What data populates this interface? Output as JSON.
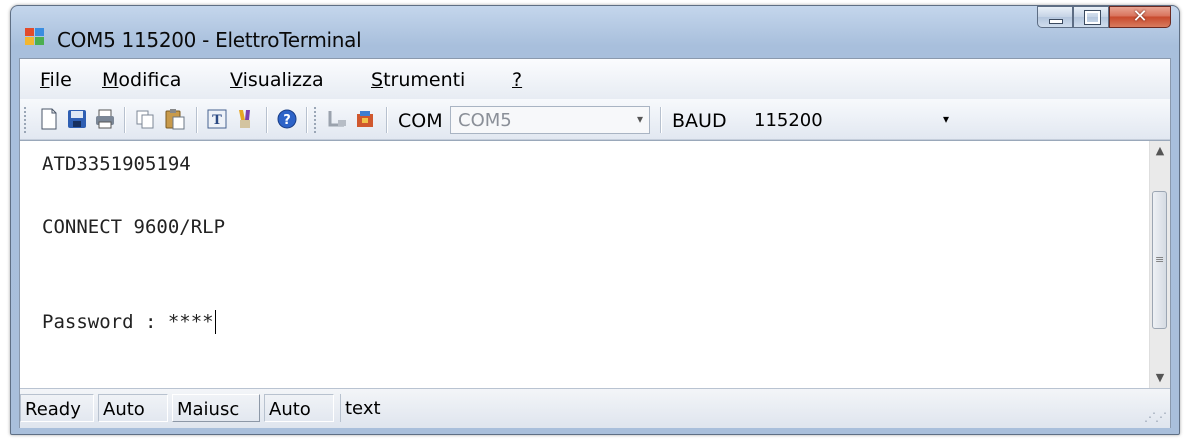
{
  "window": {
    "title": "COM5 115200 - ElettroTerminal"
  },
  "menu": {
    "items": [
      {
        "underline": "F",
        "rest": "ile"
      },
      {
        "underline": "M",
        "rest": "odifica"
      },
      {
        "underline": "V",
        "rest": "isualizza"
      },
      {
        "underline": "S",
        "rest": "trumenti"
      },
      {
        "underline": "?",
        "rest": ""
      }
    ]
  },
  "toolbar": {
    "icons": [
      "new-file-icon",
      "save-icon",
      "print-icon",
      "copy-icon",
      "paste-icon",
      "text-icon",
      "clear-icon",
      "help-icon",
      "disconnect-icon",
      "connect-icon"
    ],
    "com_label": "COM",
    "com_value": "COM5",
    "baud_label": "BAUD",
    "baud_value": "115200"
  },
  "terminal": {
    "lines": [
      "ATD3351905194",
      "",
      "CONNECT 9600/RLP",
      "",
      "",
      "Password : ****"
    ]
  },
  "status": {
    "panels": [
      "Ready",
      "Auto",
      "Maiusc",
      "Auto",
      "text"
    ]
  },
  "colors": {
    "accent": "#a9bfdb",
    "close_button": "#c84a2d"
  }
}
